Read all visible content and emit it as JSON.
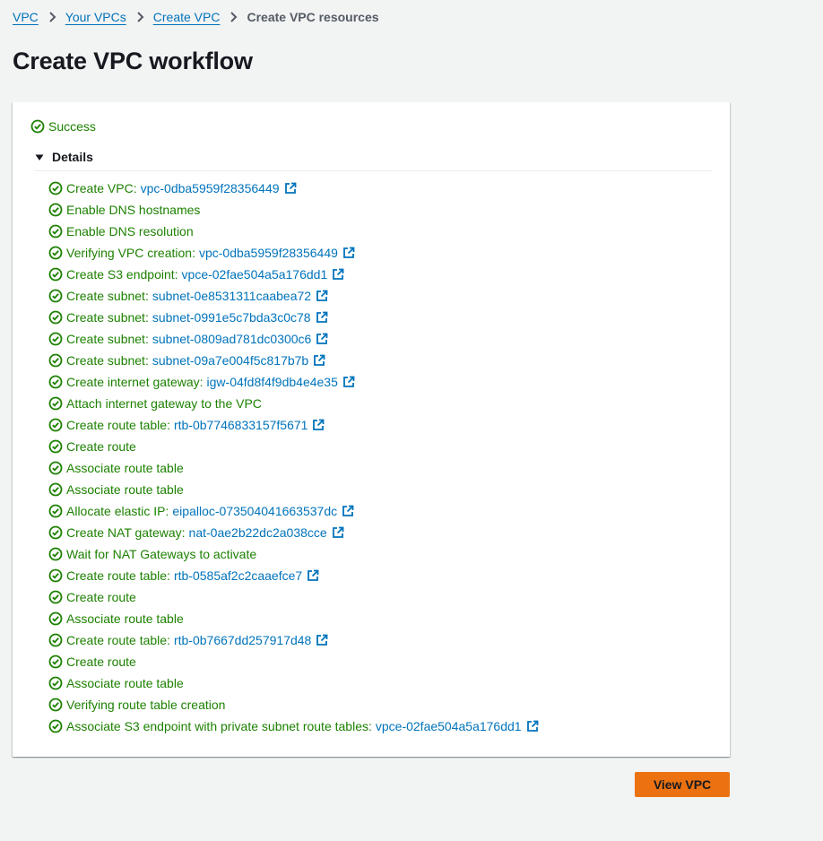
{
  "breadcrumb": {
    "items": [
      {
        "label": "VPC"
      },
      {
        "label": "Your VPCs"
      },
      {
        "label": "Create VPC"
      }
    ],
    "current": "Create VPC resources"
  },
  "page": {
    "title": "Create VPC workflow"
  },
  "status": {
    "label": "Success"
  },
  "details": {
    "label": "Details",
    "expanded": true
  },
  "steps": [
    {
      "text": "Create VPC:",
      "link": "vpc-0dba5959f28356449"
    },
    {
      "text": "Enable DNS hostnames",
      "link": null
    },
    {
      "text": "Enable DNS resolution",
      "link": null
    },
    {
      "text": "Verifying VPC creation:",
      "link": "vpc-0dba5959f28356449"
    },
    {
      "text": "Create S3 endpoint:",
      "link": "vpce-02fae504a5a176dd1"
    },
    {
      "text": "Create subnet:",
      "link": "subnet-0e8531311caabea72"
    },
    {
      "text": "Create subnet:",
      "link": "subnet-0991e5c7bda3c0c78"
    },
    {
      "text": "Create subnet:",
      "link": "subnet-0809ad781dc0300c6"
    },
    {
      "text": "Create subnet:",
      "link": "subnet-09a7e004f5c817b7b"
    },
    {
      "text": "Create internet gateway:",
      "link": "igw-04fd8f4f9db4e4e35"
    },
    {
      "text": "Attach internet gateway to the VPC",
      "link": null
    },
    {
      "text": "Create route table:",
      "link": "rtb-0b7746833157f5671"
    },
    {
      "text": "Create route",
      "link": null
    },
    {
      "text": "Associate route table",
      "link": null
    },
    {
      "text": "Associate route table",
      "link": null
    },
    {
      "text": "Allocate elastic IP:",
      "link": "eipalloc-073504041663537dc"
    },
    {
      "text": "Create NAT gateway:",
      "link": "nat-0ae2b22dc2a038cce"
    },
    {
      "text": "Wait for NAT Gateways to activate",
      "link": null
    },
    {
      "text": "Create route table:",
      "link": "rtb-0585af2c2caaefce7"
    },
    {
      "text": "Create route",
      "link": null
    },
    {
      "text": "Associate route table",
      "link": null
    },
    {
      "text": "Create route table:",
      "link": "rtb-0b7667dd257917d48"
    },
    {
      "text": "Create route",
      "link": null
    },
    {
      "text": "Associate route table",
      "link": null
    },
    {
      "text": "Verifying route table creation",
      "link": null
    },
    {
      "text": "Associate S3 endpoint with private subnet route tables:",
      "link": "vpce-02fae504a5a176dd1"
    }
  ],
  "actions": {
    "view_vpc": "View VPC"
  },
  "icons": {
    "status": "check-circle-icon",
    "external": "external-link-icon",
    "caret": "caret-down-icon",
    "separator": "chevron-right-icon"
  },
  "colors": {
    "success": "#1d8102",
    "link": "#0073bb",
    "primary_button": "#ec7211",
    "background": "#f2f3f3"
  }
}
